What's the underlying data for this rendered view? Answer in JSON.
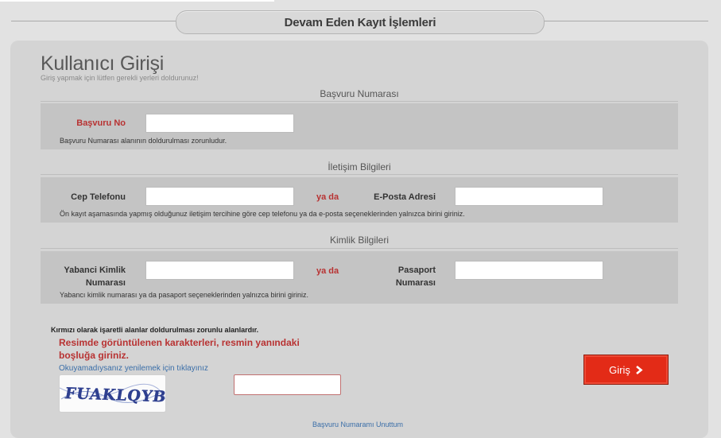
{
  "page_title": "Devam Eden Kayıt İşlemleri",
  "login": {
    "heading": "Kullanıcı Girişi",
    "subheading": "Giriş yapmak için lütfen gerekli yerleri doldurunuz!"
  },
  "sections": {
    "basvuru": {
      "title": "Başvuru Numarası",
      "label": "Başvuru No",
      "value": "",
      "hint": "Başvuru Numarası alanının doldurulması zorunludur."
    },
    "iletisim": {
      "title": "İletişim Bilgileri",
      "phone_label": "Cep Telefonu",
      "phone_value": "",
      "or_text": "ya da",
      "email_label": "E-Posta Adresi",
      "email_value": "",
      "hint": "Ön kayıt aşamasında yapmış olduğunuz iletişim tercihine göre cep telefonu ya da e-posta seçeneklerinden yalnızca birini giriniz."
    },
    "kimlik": {
      "title": "Kimlik Bilgileri",
      "foreign_id_label_1": "Yabanci Kimlik",
      "foreign_id_label_2": "Numarası",
      "foreign_id_value": "",
      "or_text": "ya da",
      "passport_label_1": "Pasaport",
      "passport_label_2": "Numarası",
      "passport_value": "",
      "hint": "Yabancı kimlik numarası ya da pasaport seçeneklerinden yalnızca birini giriniz."
    }
  },
  "required_note": "Kırmızı olarak işaretli alanlar doldurulması zorunlu alanlardır.",
  "captcha": {
    "message": "Resimde görüntülenen karakterleri, resmin yanındaki boşluğa giriniz.",
    "refresh_link": "Okuyamadıysanız yenilemek için tıklayınız",
    "image_text": "FUAKLQYB",
    "value": ""
  },
  "submit": {
    "label": "Giriş",
    "icon": "chevron-right-icon"
  },
  "bottom_link": "Başvuru Numaramı Unuttum",
  "colors": {
    "accent_red": "#e32b17",
    "label_red": "#b83232",
    "link_blue": "#3a6ea8"
  }
}
